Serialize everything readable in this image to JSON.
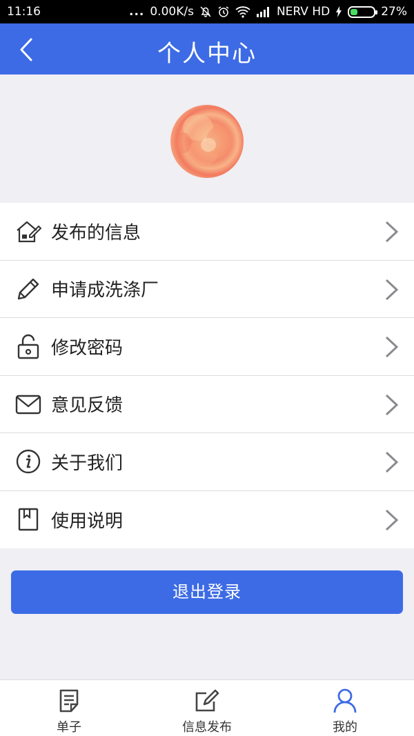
{
  "status_bar": {
    "time": "11:16",
    "dots": "...",
    "speed": "0.00K/s",
    "carrier": "NERV HD",
    "battery": "27%"
  },
  "header": {
    "title": "个人中心",
    "back_icon": "chevron-left-icon"
  },
  "profile": {
    "avatar_icon": "avatar-flower-image"
  },
  "menu": {
    "items": [
      {
        "label": "发布的信息",
        "icon": "house-pencil-icon"
      },
      {
        "label": "申请成洗涤厂",
        "icon": "pencil-icon"
      },
      {
        "label": "修改密码",
        "icon": "lock-icon"
      },
      {
        "label": "意见反馈",
        "icon": "envelope-icon"
      },
      {
        "label": "关于我们",
        "icon": "info-icon"
      },
      {
        "label": "使用说明",
        "icon": "book-icon"
      }
    ]
  },
  "actions": {
    "logout_label": "退出登录"
  },
  "tabbar": {
    "tabs": [
      {
        "label": "单子",
        "icon": "document-icon"
      },
      {
        "label": "信息发布",
        "icon": "edit-square-icon"
      },
      {
        "label": "我的",
        "icon": "person-icon",
        "active": true
      }
    ]
  },
  "colors": {
    "accent": "#3d6be5",
    "background": "#efeff4"
  }
}
